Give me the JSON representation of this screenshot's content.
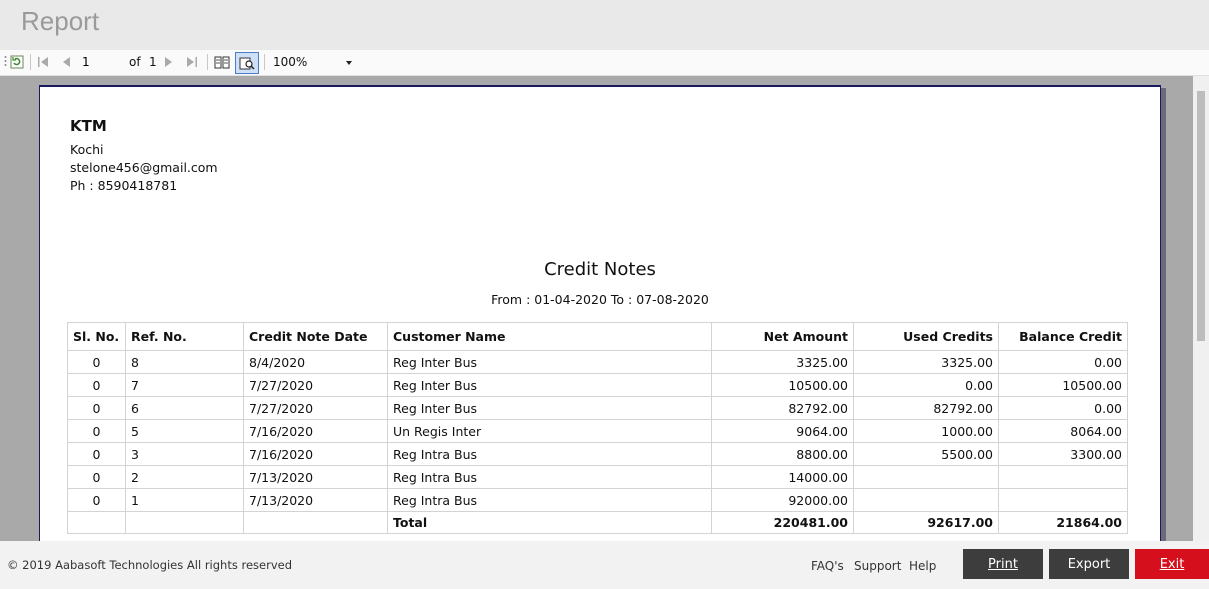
{
  "app": {
    "title": "Report"
  },
  "toolbar": {
    "page_value": "1",
    "of_label": "of",
    "total_pages": "1",
    "zoom": "100%"
  },
  "report": {
    "company": "KTM",
    "city": "Kochi",
    "email": "stelone456@gmail.com",
    "phone": "Ph : 8590418781",
    "title": "Credit Notes",
    "range": "From : 01-04-2020 To : 07-08-2020",
    "columns": [
      "Sl. No.",
      "Ref. No.",
      "Credit Note Date",
      "Customer Name",
      "Net Amount",
      "Used Credits",
      "Balance Credit"
    ],
    "rows": [
      [
        "0",
        "8",
        "8/4/2020",
        "Reg Inter Bus",
        "3325.00",
        "3325.00",
        "0.00"
      ],
      [
        "0",
        "7",
        "7/27/2020",
        "Reg Inter Bus",
        "10500.00",
        "0.00",
        "10500.00"
      ],
      [
        "0",
        "6",
        "7/27/2020",
        "Reg Inter Bus",
        "82792.00",
        "82792.00",
        "0.00"
      ],
      [
        "0",
        "5",
        "7/16/2020",
        "Un Regis Inter",
        "9064.00",
        "1000.00",
        "8064.00"
      ],
      [
        "0",
        "3",
        "7/16/2020",
        "Reg Intra Bus",
        "8800.00",
        "5500.00",
        "3300.00"
      ],
      [
        "0",
        "2",
        "7/13/2020",
        "Reg Intra Bus",
        "14000.00",
        "",
        ""
      ],
      [
        "0",
        "1",
        "7/13/2020",
        "Reg Intra Bus",
        "92000.00",
        "",
        ""
      ]
    ],
    "total": {
      "label": "Total",
      "net": "220481.00",
      "used": "92617.00",
      "balance": "21864.00"
    }
  },
  "footer": {
    "copyright": "© 2019 Aabasoft Technologies All rights reserved",
    "links": [
      "FAQ's",
      "Support",
      "Help"
    ],
    "buttons": {
      "print": "Print",
      "export": "Export",
      "exit": "Exit"
    },
    "colors": {
      "dark_button": "#3d3d3d",
      "exit_button": "#d50f1c"
    }
  }
}
